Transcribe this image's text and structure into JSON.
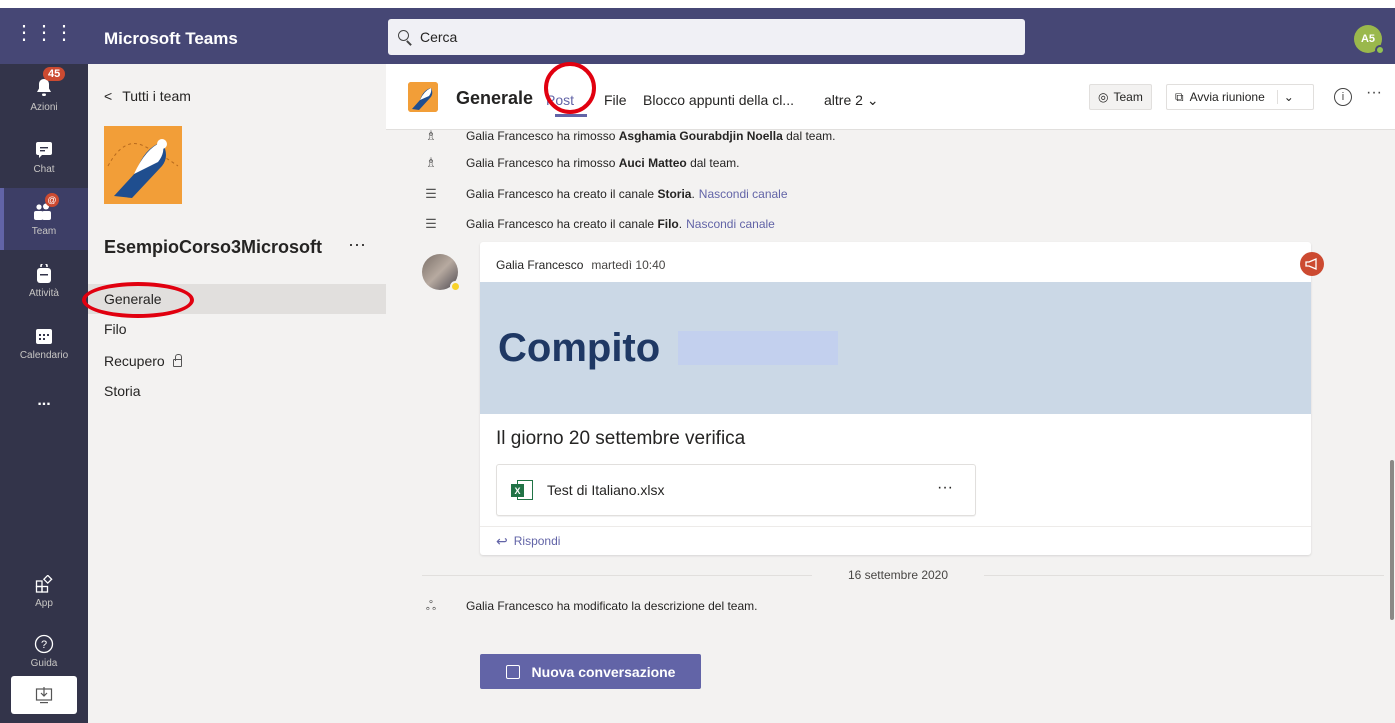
{
  "app": {
    "title": "Microsoft Teams",
    "user_initials": "A5"
  },
  "search": {
    "placeholder": "Cerca"
  },
  "rail": [
    {
      "label": "Azioni",
      "icon": "bell-icon",
      "badge": "45"
    },
    {
      "label": "Chat",
      "icon": "chat-icon"
    },
    {
      "label": "Team",
      "icon": "teams-icon",
      "badge": "@"
    },
    {
      "label": "Attività",
      "icon": "backpack-icon"
    },
    {
      "label": "Calendario",
      "icon": "calendar-icon"
    },
    {
      "label": "...",
      "icon": "more-icon"
    },
    {
      "label": "App",
      "icon": "apps-icon"
    },
    {
      "label": "Guida",
      "icon": "help-icon"
    }
  ],
  "leftpanel": {
    "back_label": "Tutti i team",
    "team_name": "EsempioCorso3Microsoft",
    "more": "···",
    "channels": [
      "Generale",
      "Filo",
      "Recupero",
      "Storia"
    ]
  },
  "header": {
    "channel_title": "Generale",
    "tabs": [
      "Post",
      "File",
      "Blocco appunti della cl...",
      "altre 2"
    ],
    "team_btn": "Team",
    "meeting_btn": "Avvia riunione",
    "more": "···"
  },
  "feed": {
    "system_messages": [
      {
        "actor": "Galia Francesco",
        "text": " ha rimosso ",
        "object": "Asghamia Gourabdjin Noella",
        "tail": " dal team.",
        "link": ""
      },
      {
        "actor": "Galia Francesco",
        "text": " ha rimosso ",
        "object": "Auci Matteo",
        "tail": " dal team.",
        "link": ""
      },
      {
        "actor": "Galia Francesco",
        "text": " ha creato il canale ",
        "object": "Storia",
        "tail": ".",
        "link": "Nascondi canale"
      },
      {
        "actor": "Galia Francesco",
        "text": " ha creato il canale ",
        "object": "Filo",
        "tail": ".",
        "link": "Nascondi canale"
      }
    ],
    "post": {
      "author": "Galia Francesco",
      "time": "martedì 10:40",
      "banner_title": "Compito",
      "body": "Il giorno 20 settembre verifica",
      "attachment": "Test di Italiano.xlsx",
      "attachment_more": "···",
      "reply": "Rispondi"
    },
    "date_separator": "16 settembre 2020",
    "desc_message": {
      "actor": "Galia Francesco",
      "text": " ha modificato la descrizione del team."
    },
    "new_conversation": "Nuova conversazione"
  }
}
